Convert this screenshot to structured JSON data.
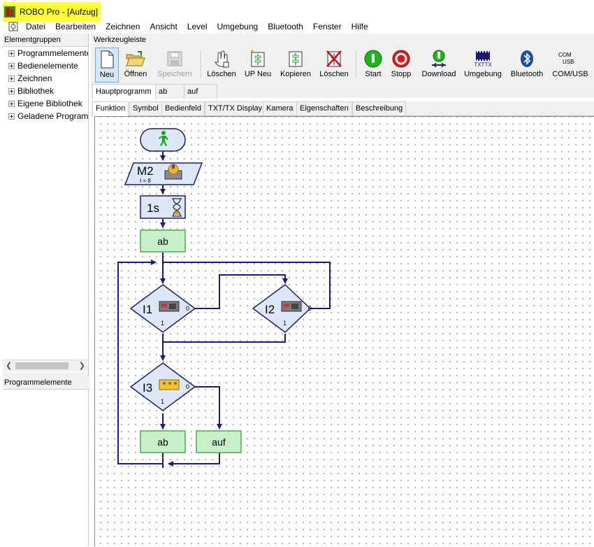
{
  "window": {
    "title": "ROBO Pro - [Aufzug]"
  },
  "menu": [
    "Datei",
    "Bearbeiten",
    "Zeichnen",
    "Ansicht",
    "Level",
    "Umgebung",
    "Bluetooth",
    "Fenster",
    "Hilfe"
  ],
  "left_panel": {
    "header": "Elementgruppen",
    "items": [
      "Programmelemente",
      "Bedienelemente",
      "Zeichnen",
      "Bibliothek",
      "Eigene Bibliothek",
      "Geladene Programme"
    ],
    "bottom_header": "Programmelemente"
  },
  "toolbar": {
    "header": "Werkzeugleiste",
    "buttons": [
      {
        "label": "Neu",
        "icon": "new-file-icon"
      },
      {
        "label": "Öffnen",
        "icon": "open-folder-icon"
      },
      {
        "label": "Speichern",
        "icon": "save-icon"
      },
      {
        "label": "Löschen",
        "icon": "delete-hand-icon"
      },
      {
        "label": "UP Neu",
        "icon": "new-subprogram-icon"
      },
      {
        "label": "Kopieren",
        "icon": "copy-icon"
      },
      {
        "label": "Löschen",
        "icon": "delete-subprogram-icon"
      },
      {
        "label": "Start",
        "icon": "start-icon"
      },
      {
        "label": "Stopp",
        "icon": "stop-icon"
      },
      {
        "label": "Download",
        "icon": "download-icon"
      },
      {
        "label": "Umgebung",
        "icon": "environment-icon"
      },
      {
        "label": "Bluetooth",
        "icon": "bluetooth-icon"
      },
      {
        "label": "COM/USB",
        "icon": "com-usb-icon"
      }
    ],
    "umgebung_icon_text": "TXTTX",
    "com_icon_text": "COM",
    "usb_icon_text": "USB"
  },
  "program_tabs": [
    "Hauptprogramm",
    "ab",
    "auf"
  ],
  "function_tabs": [
    "Funktion",
    "Symbol",
    "Bedienfeld",
    "TXT/TX Display",
    "Kamera",
    "Eigenschaften",
    "Beschreibung"
  ],
  "flowchart": {
    "motor": {
      "label": "M2",
      "sub": "I = 8"
    },
    "wait": {
      "label": "1s"
    },
    "sub1": "ab",
    "branch1": {
      "label": "I1",
      "yes": "1",
      "no": "0"
    },
    "branch2": {
      "label": "I2",
      "yes": "1",
      "no": "0"
    },
    "branch3": {
      "label": "I3",
      "yes": "1",
      "no": "0"
    },
    "sub_ab": "ab",
    "sub_auf": "auf"
  },
  "colors": {
    "highlight": "#ffff33",
    "flow_line": "#1a1a7a",
    "block_fill": "#dce7f7",
    "sub_fill": "#c8f0c8",
    "sub_border": "#44b044"
  }
}
